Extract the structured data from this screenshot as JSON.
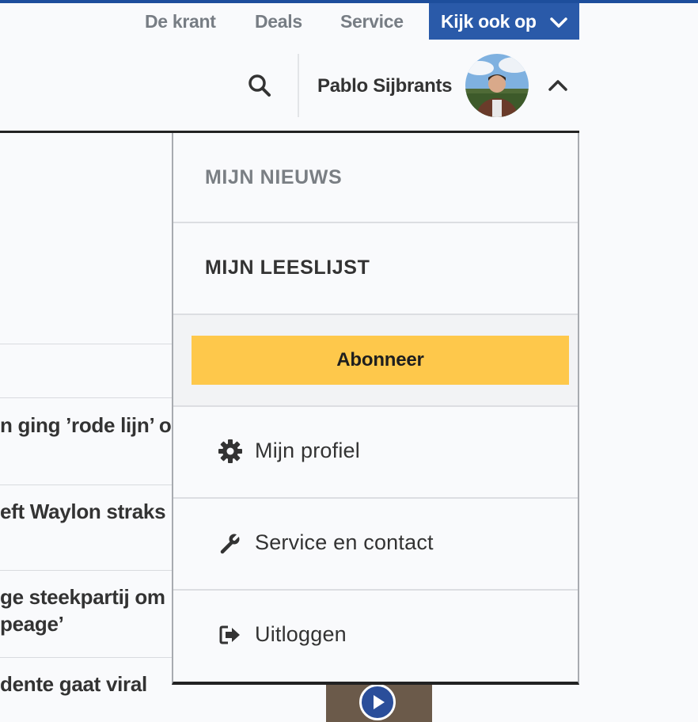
{
  "top_nav": {
    "links": [
      "De krant",
      "Deals",
      "Service"
    ],
    "kijk_ook_op": "Kijk ook op"
  },
  "header": {
    "username": "Pablo Sijbrants"
  },
  "background_headlines": [
    "n ging ’rode lijn’ o",
    "eft Waylon straks",
    "ge steekpartij om",
    "peage’",
    "dente gaat viral"
  ],
  "dropdown": {
    "mijn_nieuws": "MIJN NIEUWS",
    "mijn_leeslijst": "MIJN LEESLIJST",
    "abonneer": "Abonneer",
    "items": [
      {
        "label": "Mijn profiel",
        "icon": "gear-icon"
      },
      {
        "label": "Service en contact",
        "icon": "wrench-icon"
      },
      {
        "label": "Uitloggen",
        "icon": "logout-icon"
      }
    ]
  },
  "colors": {
    "brand_blue": "#2a5aa9",
    "subscribe_yellow": "#fec84b",
    "nav_gray": "#777d84"
  }
}
